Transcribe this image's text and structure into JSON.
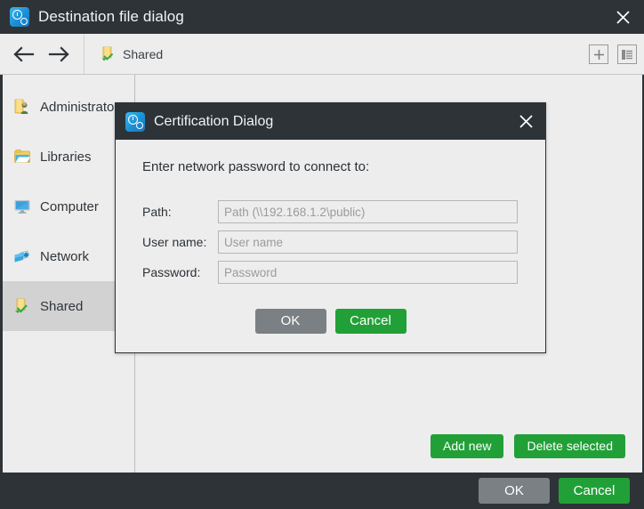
{
  "window": {
    "title": "Destination file dialog",
    "icon": "app-clock-gear-icon",
    "close_label": "✕"
  },
  "navbar": {
    "back_icon": "arrow-left-icon",
    "forward_icon": "arrow-right-icon",
    "breadcrumb": {
      "icon": "shared-folder-icon",
      "label": "Shared"
    },
    "add_button_icon": "plus-icon",
    "details_view_icon": "list-view-icon"
  },
  "sidebar": {
    "items": [
      {
        "label": "Administrator",
        "icon": "user-folder-icon",
        "selected": false
      },
      {
        "label": "Libraries",
        "icon": "libraries-folder-icon",
        "selected": false
      },
      {
        "label": "Computer",
        "icon": "monitor-icon",
        "selected": false
      },
      {
        "label": "Network",
        "icon": "network-icon",
        "selected": false
      },
      {
        "label": "Shared",
        "icon": "shared-folder-icon",
        "selected": true
      }
    ]
  },
  "content": {
    "add_new_label": "Add new",
    "delete_selected_label": "Delete selected"
  },
  "footer": {
    "ok_label": "OK",
    "cancel_label": "Cancel"
  },
  "dialog": {
    "title": "Certification Dialog",
    "icon": "app-clock-gear-icon",
    "close_label": "✕",
    "prompt": "Enter network password to connect to:",
    "fields": [
      {
        "label": "Path:",
        "value": "",
        "placeholder": "Path (\\\\192.168.1.2\\public)"
      },
      {
        "label": "User name:",
        "value": "",
        "placeholder": "User name"
      },
      {
        "label": "Password:",
        "value": "",
        "placeholder": "Password"
      }
    ],
    "ok_label": "OK",
    "cancel_label": "Cancel"
  },
  "colors": {
    "chrome_dark": "#2e3338",
    "surface": "#ededed",
    "accent_green": "#22a038",
    "muted_gray": "#7b8085",
    "selection": "#d2d2d2"
  }
}
